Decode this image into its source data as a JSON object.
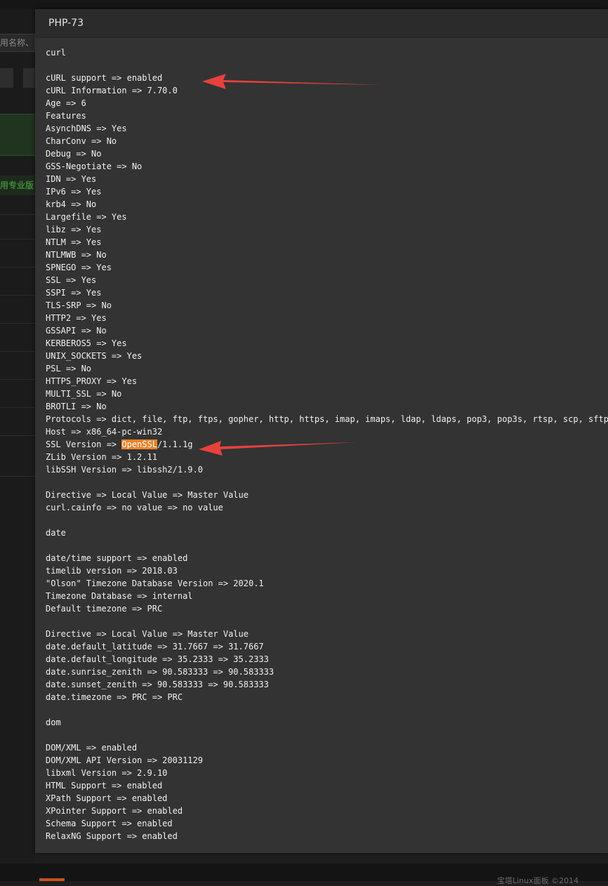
{
  "background": {
    "search_placeholder": "用名称、",
    "pro_label": "用专业版",
    "footer_text": "宝塔Linux面板 ©2014"
  },
  "modal": {
    "title": "PHP-73",
    "curl": {
      "heading": "curl",
      "support": "cURL support => enabled",
      "information": "cURL Information => 7.70.0",
      "age": "Age => 6",
      "features": "Features",
      "asynchdns": "AsynchDNS => Yes",
      "charconv": "CharConv => No",
      "debug": "Debug => No",
      "gss_negotiate": "GSS-Negotiate => No",
      "idn": "IDN => Yes",
      "ipv6": "IPv6 => Yes",
      "krb4": "krb4 => No",
      "largefile": "Largefile => Yes",
      "libz": "libz => Yes",
      "ntlm": "NTLM => Yes",
      "ntlmwb": "NTLMWB => No",
      "spnego": "SPNEGO => Yes",
      "ssl": "SSL => Yes",
      "sspi": "SSPI => Yes",
      "tls_srp": "TLS-SRP => No",
      "http2": "HTTP2 => Yes",
      "gssapi": "GSSAPI => No",
      "kerberos5": "KERBEROS5 => Yes",
      "unix_sockets": "UNIX_SOCKETS => Yes",
      "psl": "PSL => No",
      "https_proxy": "HTTPS_PROXY => Yes",
      "multi_ssl": "MULTI_SSL => No",
      "brotli": "BROTLI => No",
      "protocols": "Protocols => dict, file, ftp, ftps, gopher, http, https, imap, imaps, ldap, ldaps, pop3, pop3s, rtsp, scp, sftp, smb, smbs, smtp, smtps, telnet, tftp",
      "host": "Host => x86_64-pc-win32",
      "ssl_version_prefix": "SSL Version => ",
      "ssl_version_highlight": "OpenSSL",
      "ssl_version_suffix": "/1.1.1g",
      "zlib_version": "ZLib Version => 1.2.11",
      "libssh_version": "libSSH Version => libssh2/1.9.0",
      "directive_header": "Directive => Local Value => Master Value",
      "cainfo": "curl.cainfo => no value => no value"
    },
    "date": {
      "heading": "date",
      "support": "date/time support => enabled",
      "timelib": "timelib version => 2018.03",
      "olson": "\"Olson\" Timezone Database Version => 2020.1",
      "tz_database": "Timezone Database => internal",
      "default_tz": "Default timezone => PRC",
      "directive_header": "Directive => Local Value => Master Value",
      "default_latitude": "date.default_latitude => 31.7667 => 31.7667",
      "default_longitude": "date.default_longitude => 35.2333 => 35.2333",
      "sunrise_zenith": "date.sunrise_zenith => 90.583333 => 90.583333",
      "sunset_zenith": "date.sunset_zenith => 90.583333 => 90.583333",
      "timezone": "date.timezone => PRC => PRC"
    },
    "dom": {
      "heading": "dom",
      "xml": "DOM/XML => enabled",
      "api_version": "DOM/XML API Version => 20031129",
      "libxml": "libxml Version => 2.9.10",
      "html_support": "HTML Support => enabled",
      "xpath": "XPath Support => enabled",
      "xpointer": "XPointer Support => enabled",
      "schema": "Schema Support => enabled",
      "relaxng": "RelaxNG Support => enabled"
    }
  },
  "annotation_color": "#e8413c",
  "highlight_color": "#e8832a"
}
